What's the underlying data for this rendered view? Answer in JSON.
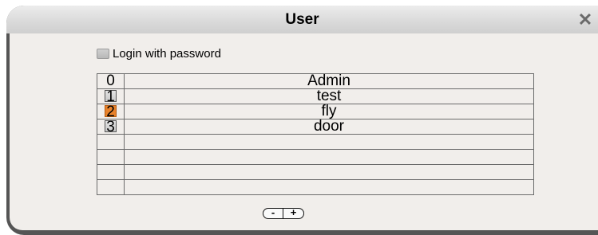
{
  "window": {
    "title": "User",
    "close_symbol": "✕"
  },
  "options": {
    "login_with_password_label": "Login with password",
    "login_with_password_checked": false
  },
  "users": [
    {
      "index": "0",
      "name": "Admin",
      "index_style": "plain"
    },
    {
      "index": "1",
      "name": "test",
      "index_style": "framed"
    },
    {
      "index": "2",
      "name": "fly",
      "index_style": "selected"
    },
    {
      "index": "3",
      "name": "door",
      "index_style": "framed"
    },
    {
      "index": "",
      "name": "",
      "index_style": "plain"
    },
    {
      "index": "",
      "name": "",
      "index_style": "plain"
    },
    {
      "index": "",
      "name": "",
      "index_style": "plain"
    },
    {
      "index": "",
      "name": "",
      "index_style": "plain"
    }
  ],
  "controls": {
    "remove_label": "-",
    "add_label": "+"
  },
  "colors": {
    "selected_accent": "#e8822b",
    "frame": "#555555",
    "content_bg": "#f1eeeb"
  }
}
